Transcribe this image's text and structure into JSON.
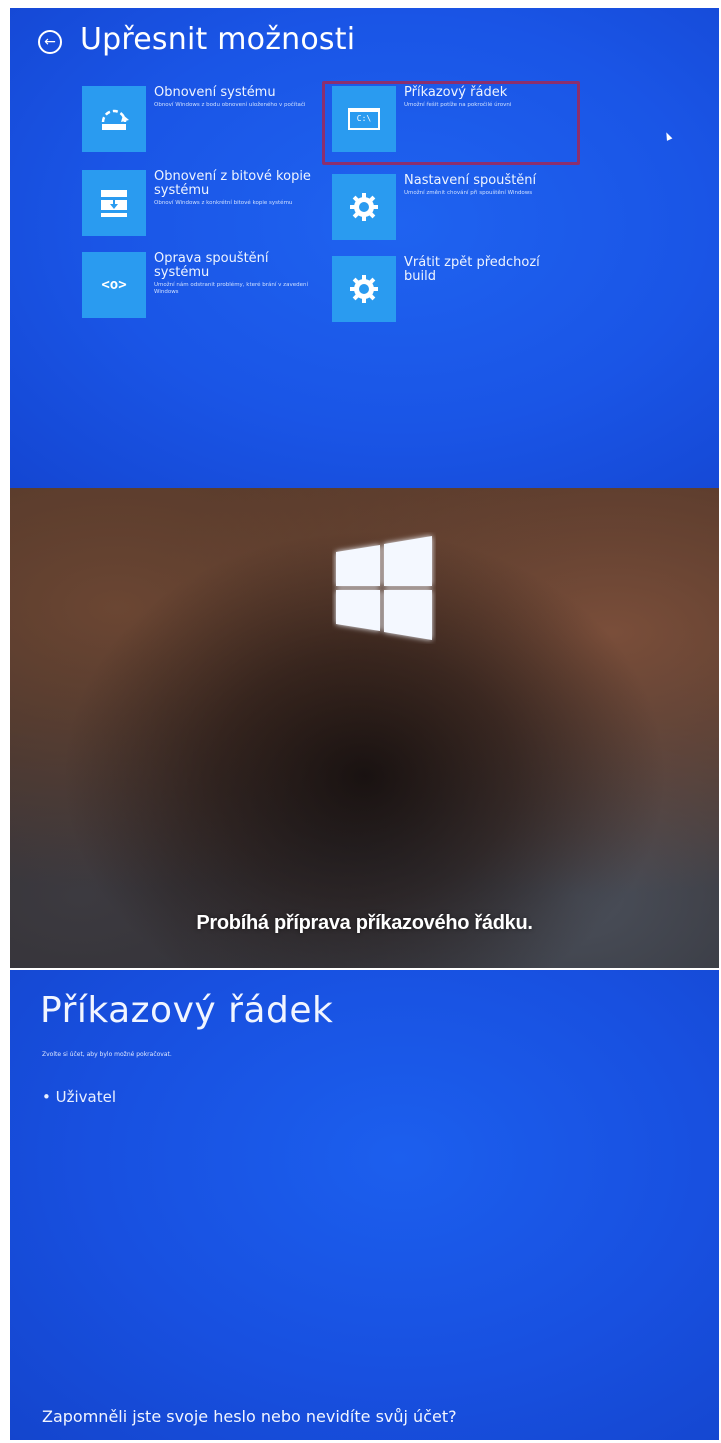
{
  "advanced_options": {
    "title": "Upřesnit možnosti",
    "options": [
      {
        "title": "Obnovení systému",
        "description": "Obnoví Windows z bodu obnovení uloženého v počítači",
        "icon": "system-restore-icon"
      },
      {
        "title": "Příkazový řádek",
        "description": "Umožní řešit potíže na pokročilé úrovni",
        "icon": "command-prompt-icon",
        "icon_text": "C:\\",
        "selected": true
      },
      {
        "title": "Obnovení z bitové kopie systému",
        "description": "Obnoví Windows z konkrétní bitové kopie systému",
        "icon": "image-recovery-icon"
      },
      {
        "title": "Nastavení spouštění",
        "description": "Umožní změnit chování při spouštění Windows",
        "icon": "gear-icon"
      },
      {
        "title": "Oprava spouštění systému",
        "description": "Umožní nám odstranit problémy, které brání v zavedení Windows",
        "icon": "startup-repair-icon",
        "icon_text": "<o>"
      },
      {
        "title": "Vrátit zpět předchozí build",
        "description": "",
        "icon": "gear-icon"
      }
    ],
    "highlight_color": "#8c2f6e"
  },
  "boot_screen": {
    "status": "Probíhá příprava příkazového řádku."
  },
  "command_prompt": {
    "title": "Příkazový řádek",
    "subtitle": "Zvolte si účet, aby bylo možné pokračovat.",
    "accounts": [
      "Uživatel"
    ],
    "forgot_link": "Zapomněli jste svoje heslo nebo nevidíte svůj účet?"
  },
  "colors": {
    "background_blue": "#1a55e6",
    "tile_blue": "#2a9bf0"
  }
}
